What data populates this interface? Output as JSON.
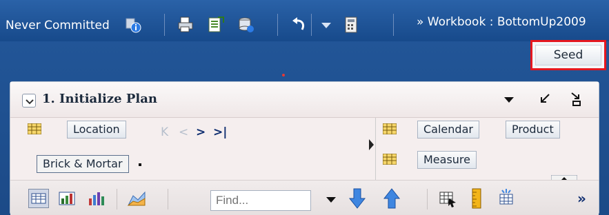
{
  "topbar": {
    "status_text": "Never Committed",
    "workbook_title": "» Workbook : BottomUp2009",
    "icons": [
      "info-icon",
      "print-icon",
      "export-excel-icon",
      "database-icon",
      "undo-icon",
      "undo-dropdown-icon",
      "calculator-icon"
    ]
  },
  "actions": {
    "seed_label": "Seed",
    "highlight_color": "#e5171f"
  },
  "panel": {
    "title": "1. Initialize Plan",
    "left_dims": {
      "dimension_label": "Location",
      "selected_member": "Brick & Mortar"
    },
    "right_dims": [
      {
        "label": "Calendar"
      },
      {
        "label": "Product"
      },
      {
        "label": "Measure"
      }
    ],
    "nav": {
      "first": "K",
      "prev": "<",
      "next": ">",
      "last": ">|"
    }
  },
  "bottom_toolbar": {
    "find_placeholder": "Find...",
    "more": "»"
  },
  "colors": {
    "accent_blue": "#1f4e8c",
    "panel_bg": "#f5eeee"
  }
}
